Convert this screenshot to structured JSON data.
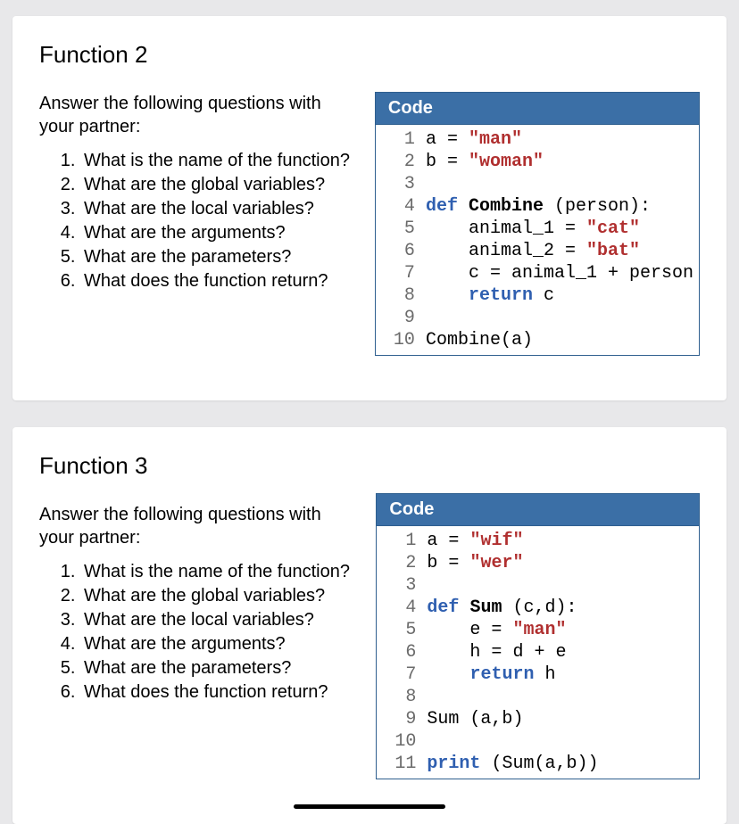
{
  "sections": [
    {
      "title": "Function 2",
      "intro": "Answer the following questions with your partner:",
      "questions": [
        "What is the name of the function?",
        "What are the global variables?",
        "What are the local variables?",
        "What are the arguments?",
        "What are the parameters?",
        "What does the function return?"
      ],
      "code": {
        "header": "Code",
        "lineNumbers": "  1\n  2\n  3\n  4\n  5\n  6\n  7\n  8\n  9\n 10",
        "tokens": [
          [
            {
              "t": "a = ",
              "c": "nm"
            },
            {
              "t": "\"man\"",
              "c": "str"
            }
          ],
          [
            {
              "t": "b = ",
              "c": "nm"
            },
            {
              "t": "\"woman\"",
              "c": "str"
            }
          ],
          [
            {
              "t": " ",
              "c": "nm"
            }
          ],
          [
            {
              "t": "def ",
              "c": "kw"
            },
            {
              "t": "Combine ",
              "c": "fn"
            },
            {
              "t": "(person):",
              "c": "nm"
            }
          ],
          [
            {
              "t": "    animal_1 = ",
              "c": "nm"
            },
            {
              "t": "\"cat\"",
              "c": "str"
            }
          ],
          [
            {
              "t": "    animal_2 = ",
              "c": "nm"
            },
            {
              "t": "\"bat\"",
              "c": "str"
            }
          ],
          [
            {
              "t": "    c = animal_1 + person",
              "c": "nm"
            }
          ],
          [
            {
              "t": "    ",
              "c": "nm"
            },
            {
              "t": "return ",
              "c": "kw"
            },
            {
              "t": "c",
              "c": "nm"
            }
          ],
          [
            {
              "t": " ",
              "c": "nm"
            }
          ],
          [
            {
              "t": "Combine(a)",
              "c": "nm"
            }
          ]
        ]
      }
    },
    {
      "title": "Function 3",
      "intro": "Answer the following questions with your partner:",
      "questions": [
        "What is the name of the function?",
        "What are the global variables?",
        "What are the local variables?",
        "What are the arguments?",
        "What are the parameters?",
        "What does the function return?"
      ],
      "code": {
        "header": "Code",
        "lineNumbers": "  1\n  2\n  3\n  4\n  5\n  6\n  7\n  8\n  9\n 10\n 11",
        "tokens": [
          [
            {
              "t": "a = ",
              "c": "nm"
            },
            {
              "t": "\"wif\"",
              "c": "str"
            }
          ],
          [
            {
              "t": "b = ",
              "c": "nm"
            },
            {
              "t": "\"wer\"",
              "c": "str"
            }
          ],
          [
            {
              "t": " ",
              "c": "nm"
            }
          ],
          [
            {
              "t": "def ",
              "c": "kw"
            },
            {
              "t": "Sum ",
              "c": "fn"
            },
            {
              "t": "(c,d):",
              "c": "nm"
            }
          ],
          [
            {
              "t": "    e = ",
              "c": "nm"
            },
            {
              "t": "\"man\"",
              "c": "str"
            }
          ],
          [
            {
              "t": "    h = d + e",
              "c": "nm"
            }
          ],
          [
            {
              "t": "    ",
              "c": "nm"
            },
            {
              "t": "return ",
              "c": "kw"
            },
            {
              "t": "h",
              "c": "nm"
            }
          ],
          [
            {
              "t": " ",
              "c": "nm"
            }
          ],
          [
            {
              "t": "Sum (a,b)",
              "c": "nm"
            }
          ],
          [
            {
              "t": " ",
              "c": "nm"
            }
          ],
          [
            {
              "t": "print ",
              "c": "kw"
            },
            {
              "t": "(Sum(a,b))",
              "c": "nm"
            }
          ]
        ]
      }
    }
  ]
}
